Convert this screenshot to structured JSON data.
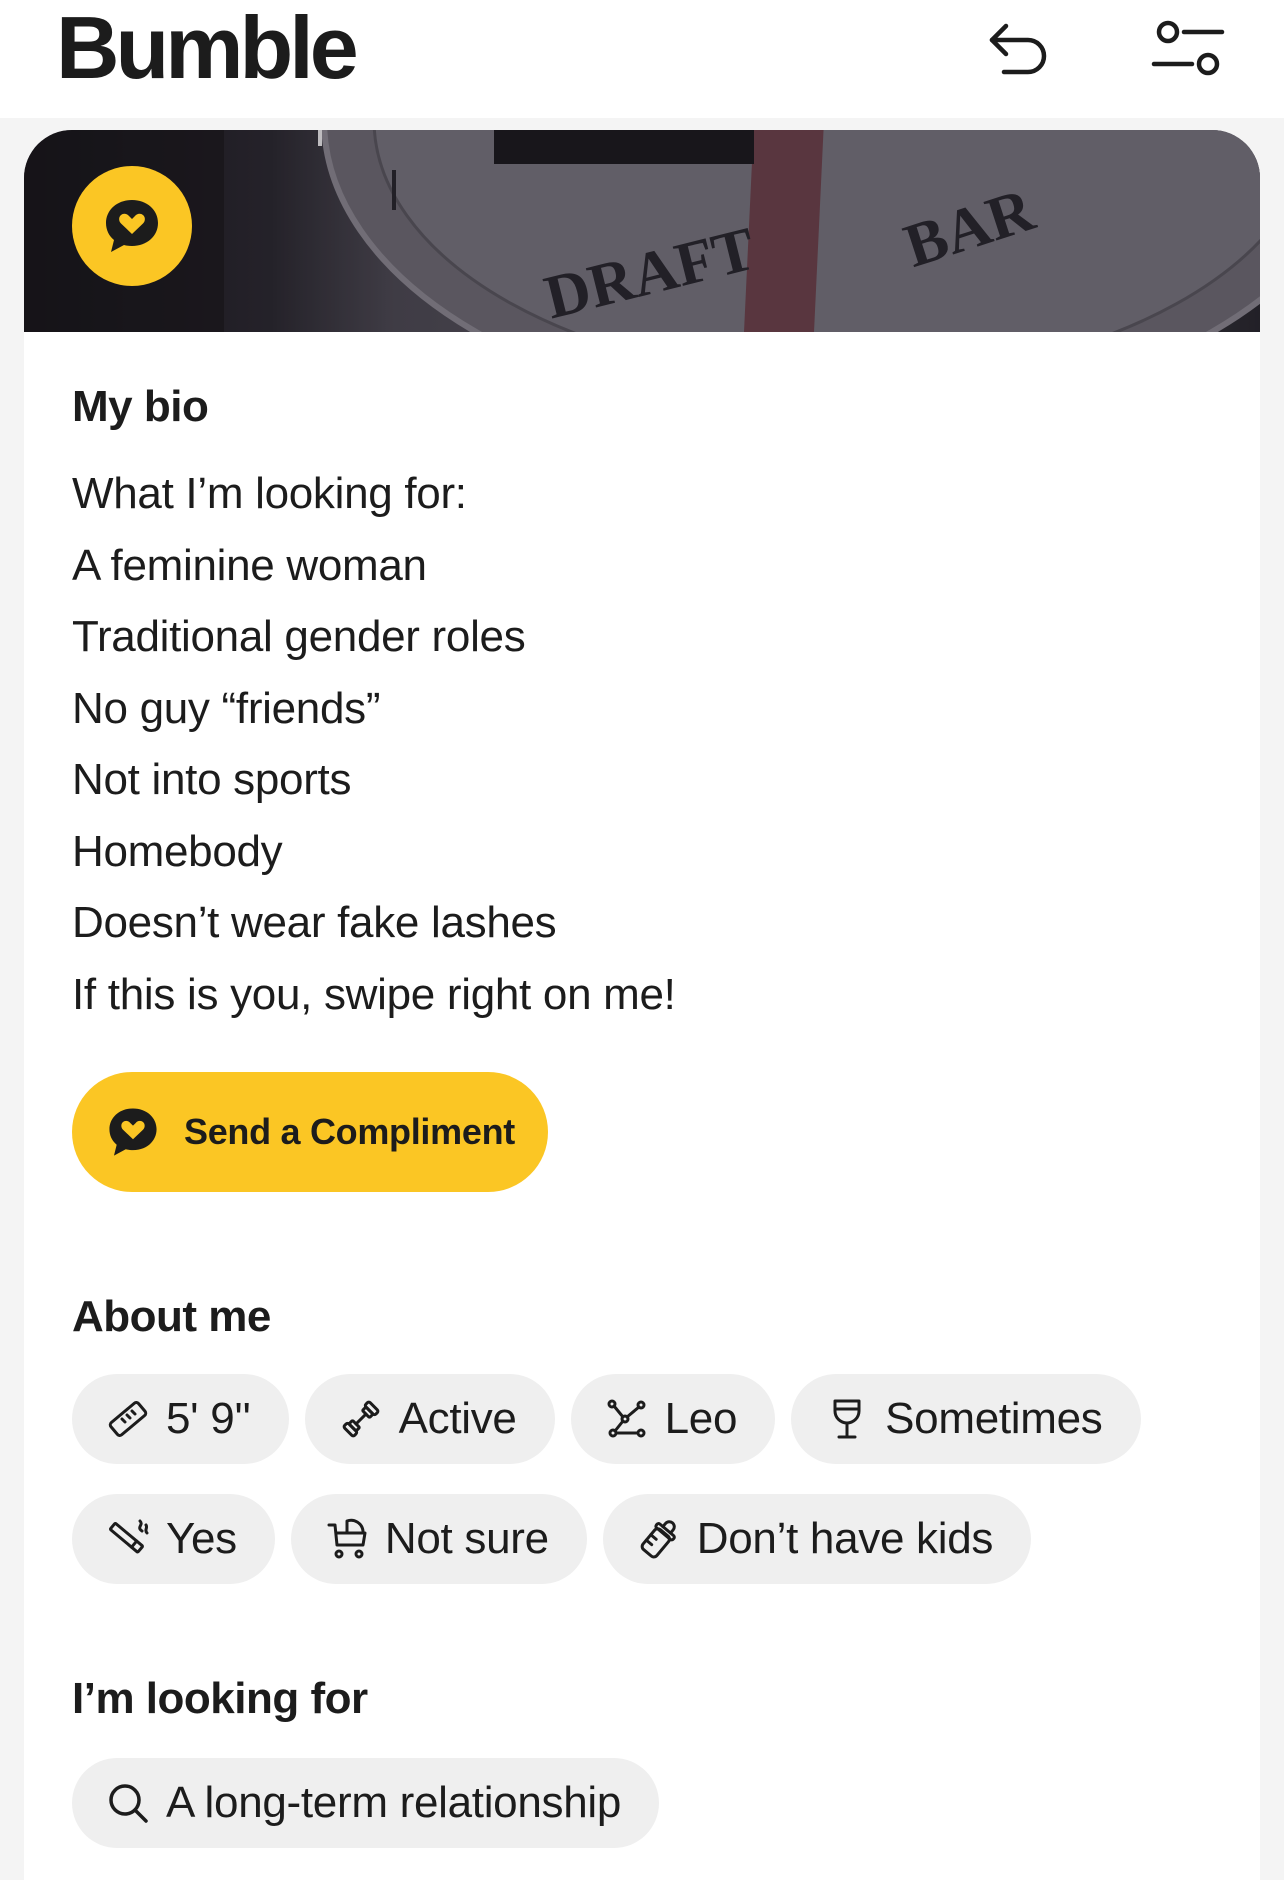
{
  "header": {
    "logo": "Bumble",
    "undo_icon": "undo-arrow-icon",
    "filter_icon": "filter-sliders-icon"
  },
  "photo": {
    "sign_text_left": "DRAFT",
    "sign_text_right": "BAR",
    "badge_icon": "compliment-heart-bubble-icon"
  },
  "bio": {
    "title": "My bio",
    "lines": [
      "What I’m looking for:",
      "A feminine woman",
      "Traditional gender roles",
      "No guy “friends”",
      "Not into sports",
      "Homebody",
      "Doesn’t wear fake lashes",
      "If this is you, swipe right on me!"
    ]
  },
  "compliment_button": {
    "label": "Send a Compliment",
    "icon": "compliment-heart-bubble-icon"
  },
  "about": {
    "title": "About me",
    "chips": [
      {
        "icon": "ruler-icon",
        "label": "5' 9''"
      },
      {
        "icon": "dumbbell-icon",
        "label": "Active"
      },
      {
        "icon": "constellation-icon",
        "label": "Leo"
      },
      {
        "icon": "wine-glass-icon",
        "label": "Sometimes"
      },
      {
        "icon": "no-smoking-icon",
        "label": "Yes"
      },
      {
        "icon": "stroller-icon",
        "label": "Not sure"
      },
      {
        "icon": "baby-bottle-icon",
        "label": "Don’t have kids"
      }
    ]
  },
  "looking_for": {
    "title": "I’m looking for",
    "chip": {
      "icon": "search-icon",
      "label": "A long-term relationship"
    }
  },
  "colors": {
    "accent": "#fbc624",
    "chip_bg": "#efefef",
    "text": "#1c1c1c",
    "page_bg": "#f4f4f4"
  }
}
